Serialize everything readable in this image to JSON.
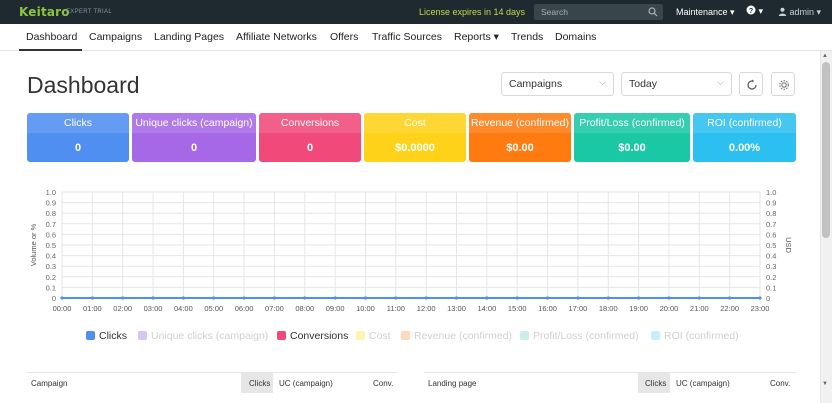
{
  "topbar": {
    "logo": "Keitaro",
    "logo_edition": "EXPERT TRIAL",
    "license_notice": "License expires in 14 days",
    "search_placeholder": "Search",
    "maintenance_label": "Maintenance ▾",
    "help_label": "? ▾",
    "user_label": "admin ▾"
  },
  "nav": {
    "items": [
      "Dashboard",
      "Campaigns",
      "Landing Pages",
      "Affiliate Networks",
      "Offers",
      "Traffic Sources",
      "Reports ▾",
      "Trends",
      "Domains"
    ],
    "active": "Dashboard"
  },
  "header": {
    "title": "Dashboard",
    "entity_select": "Campaigns",
    "period_select": "Today"
  },
  "metrics": [
    {
      "label": "Clicks",
      "value": "0",
      "color": "#4f8ff2"
    },
    {
      "label": "Unique clicks (campaign)",
      "value": "0",
      "color": "#a768e8"
    },
    {
      "label": "Conversions",
      "value": "0",
      "color": "#f0497a"
    },
    {
      "label": "Cost",
      "value": "$0.0000",
      "color": "#ffd21a"
    },
    {
      "label": "Revenue (confirmed)",
      "value": "$0.00",
      "color": "#ff7a0f"
    },
    {
      "label": "Profit/Loss (confirmed)",
      "value": "$0.00",
      "color": "#1bc8a6"
    },
    {
      "label": "ROI (confirmed)",
      "value": "0.00%",
      "color": "#2cc0f0"
    }
  ],
  "chart_data": {
    "type": "line",
    "x": [
      "00:00",
      "01:00",
      "02:00",
      "03:00",
      "04:00",
      "05:00",
      "06:00",
      "07:00",
      "08:00",
      "09:00",
      "10:00",
      "11:00",
      "12:00",
      "13:00",
      "14:00",
      "15:00",
      "16:00",
      "17:00",
      "18:00",
      "19:00",
      "20:00",
      "21:00",
      "22:00",
      "23:00"
    ],
    "ylabel": "Volume or %",
    "y2label": "USD",
    "ylim": [
      0,
      1.0
    ],
    "y2lim": [
      0,
      1.0
    ],
    "yticks": [
      "0",
      "0.1",
      "0.2",
      "0.3",
      "0.4",
      "0.5",
      "0.6",
      "0.7",
      "0.8",
      "0.9",
      "1.0"
    ],
    "grid": true,
    "legend_position": "bottom",
    "series": [
      {
        "name": "Clicks",
        "color": "#4f8ff2",
        "active": true,
        "values": [
          0,
          0,
          0,
          0,
          0,
          0,
          0,
          0,
          0,
          0,
          0,
          0,
          0,
          0,
          0,
          0,
          0,
          0,
          0,
          0,
          0,
          0,
          0,
          0
        ]
      },
      {
        "name": "Unique clicks (campaign)",
        "color": "#d9c6f5",
        "active": false,
        "values": []
      },
      {
        "name": "Conversions",
        "color": "#f0497a",
        "active": true,
        "values": []
      },
      {
        "name": "Cost",
        "color": "#fff3b0",
        "active": false,
        "values": []
      },
      {
        "name": "Revenue (confirmed)",
        "color": "#ffd9bb",
        "active": false,
        "values": []
      },
      {
        "name": "Profit/Loss (confirmed)",
        "color": "#c9f0e8",
        "active": false,
        "values": []
      },
      {
        "name": "ROI (confirmed)",
        "color": "#c8eefb",
        "active": false,
        "values": []
      }
    ]
  },
  "tables": [
    {
      "name_header": "Campaign",
      "columns": [
        "Clicks",
        "UC (campaign)",
        "Conv."
      ]
    },
    {
      "name_header": "Landing page",
      "columns": [
        "Clicks",
        "UC (campaign)",
        "Conv."
      ]
    }
  ]
}
